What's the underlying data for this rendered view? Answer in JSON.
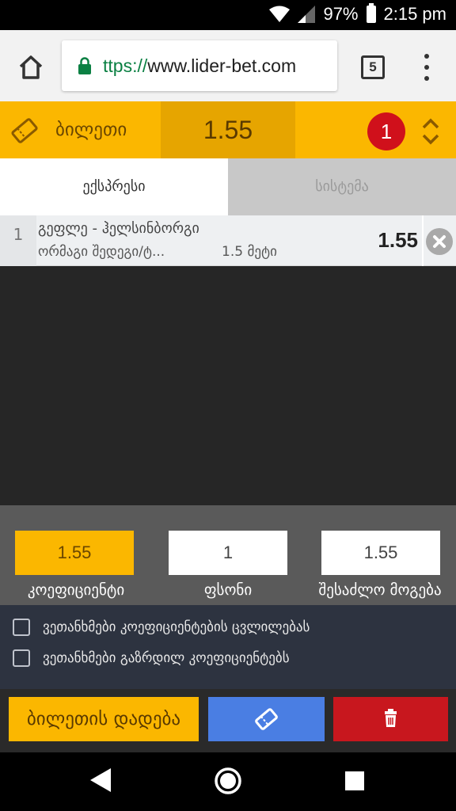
{
  "status_bar": {
    "battery": "97%",
    "time": "2:15 pm"
  },
  "browser": {
    "url_scheme": "ttps://",
    "url_host": "www.lider-bet.com",
    "tab_count": "5"
  },
  "ticket": {
    "title": "ბილეთი",
    "total_odds": "1.55",
    "count": "1"
  },
  "tabs": {
    "express": "ექსპრესი",
    "system": "სისტემა"
  },
  "bet": {
    "index": "1",
    "event": "გეფლე - ჰელსინბორგი",
    "market": "ორმაგი შედეგი/ტ...",
    "outcome": "1.5 მეტი",
    "odds": "1.55"
  },
  "summary": {
    "coefficient_value": "1.55",
    "stake_value": "1",
    "possible_win_value": "1.55",
    "coefficient_label": "კოეფიციენტი",
    "stake_label": "ფსონი",
    "possible_win_label": "შესაძლო მოგება"
  },
  "agreements": {
    "accept_changes": "ვეთანხმები კოეფიციენტების ცვლილებას",
    "accept_increased": "ვეთანხმები გაზრდილ კოეფიციენტებს"
  },
  "actions": {
    "place_bet": "ბილეთის დადება"
  },
  "colors": {
    "accent": "#fbb700",
    "badge": "#d0101b",
    "edit": "#4a7ee3",
    "delete": "#c8171e"
  }
}
